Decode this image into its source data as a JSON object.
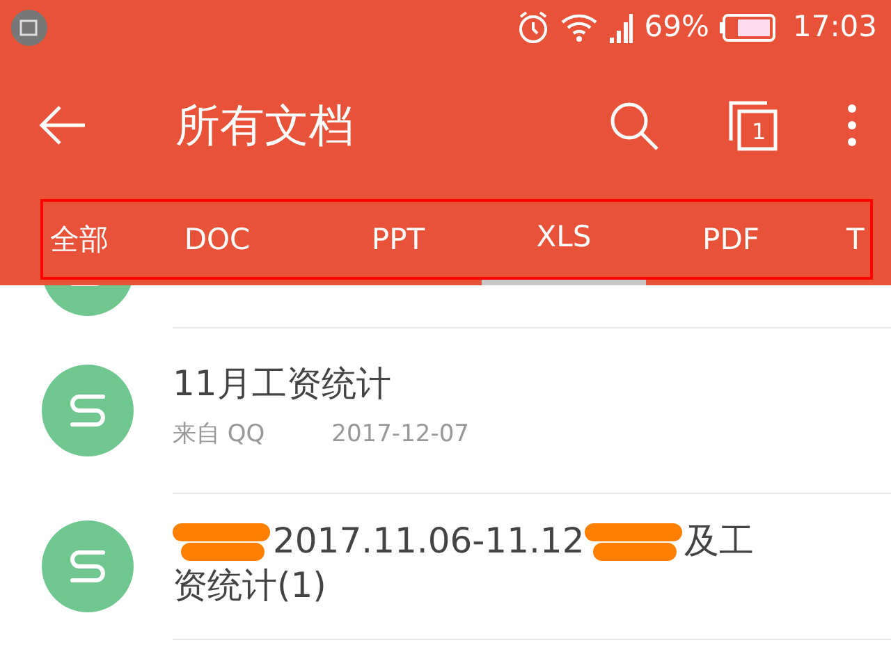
{
  "status_bar": {
    "battery": "69%",
    "time": "17:03"
  },
  "app_bar": {
    "title": "所有文档"
  },
  "toolbar_badge": "1",
  "tabs": [
    {
      "label": "全部",
      "selected": false
    },
    {
      "label": "DOC",
      "selected": false
    },
    {
      "label": "PPT",
      "selected": false
    },
    {
      "label": "XLS",
      "selected": true
    },
    {
      "label": "PDF",
      "selected": false
    },
    {
      "label": "T",
      "selected": false
    }
  ],
  "files": [
    {
      "kind": "cut"
    },
    {
      "kind": "file",
      "title": [
        {
          "kind": "text",
          "text": "11月工资统计"
        }
      ],
      "source": "来自 QQ",
      "date": "2017-12-07"
    },
    {
      "kind": "file",
      "title": [
        {
          "kind": "redaction"
        },
        {
          "kind": "text",
          "text": "2017.11.06-11.12"
        },
        {
          "kind": "redaction"
        },
        {
          "kind": "text",
          "text": "及工"
        }
      ],
      "title_line_2": "资统计(1)"
    }
  ]
}
